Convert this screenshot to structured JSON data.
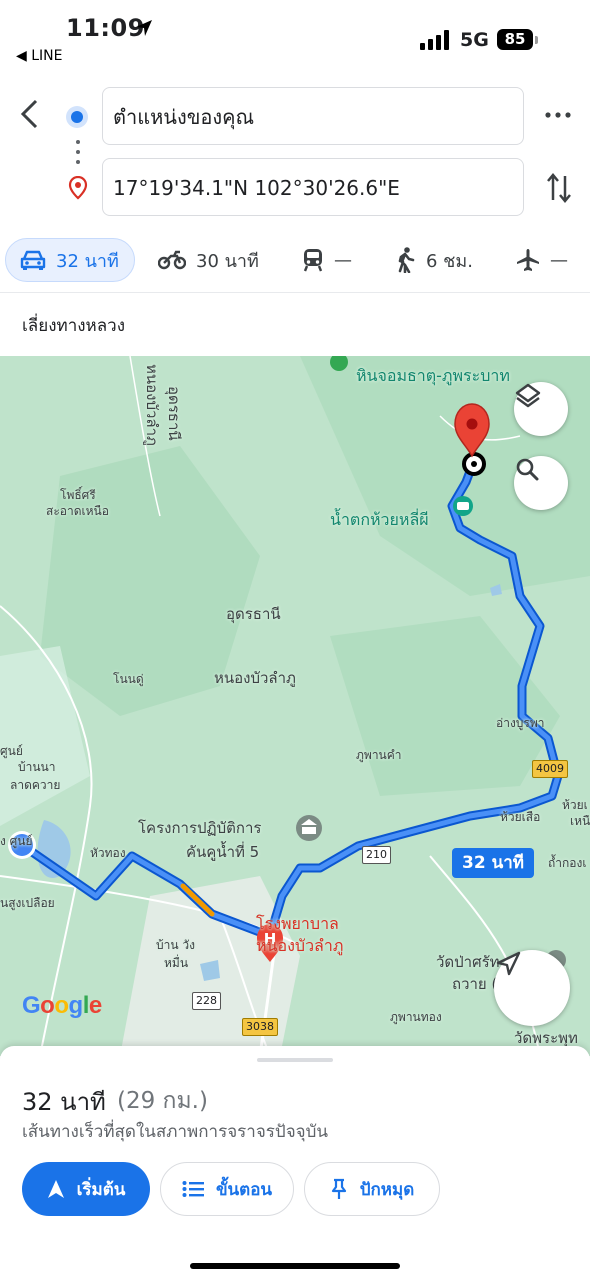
{
  "status_bar": {
    "time": "11:09",
    "back_app": "◀ LINE",
    "network": "5G",
    "battery": "85"
  },
  "directions": {
    "origin": "ตำแหน่งของคุณ",
    "destination": "17°19'34.1\"N 102°30'26.6\"E"
  },
  "modes": [
    {
      "id": "car",
      "label": "32 นาที",
      "icon": "car-icon",
      "selected": true
    },
    {
      "id": "motorbike",
      "label": "30 นาที",
      "icon": "motorbike-icon"
    },
    {
      "id": "transit",
      "label": "—",
      "icon": "train-icon"
    },
    {
      "id": "walk",
      "label": "6 ชม.",
      "icon": "walk-icon"
    },
    {
      "id": "flight",
      "label": "—",
      "icon": "flight-icon"
    }
  ],
  "avoid_label": "เลี่ยงทางหลวง",
  "map": {
    "labels": {
      "rock_pillar": "หินจอมธาตุ-ภูพระบาท",
      "udon_rotated": "อุดรธานี",
      "nongbua_rotated": "หนองบัวลำภู",
      "pho_si": "โพธิ์ศรี",
      "sa_at_nuea": "สะอาดเหนือ",
      "waterfall": "น้ำตกห้วยหลี่ผี",
      "udon": "อุดรธานี",
      "nongbua": "หนองบัวลำภู",
      "non_du": "โนนดู่",
      "ang_burapha": "อ่างบูรพา",
      "phu_phan_kham": "ภูพานคำ",
      "ban_na": "บ้านนา",
      "lat_khwai": "ลาดควาย",
      "sun": "ศูนย์",
      "project": "โครงการปฏิบัติการ",
      "project2": "คันคูน้ำที่ 5",
      "hua_thong": "หัวทอง",
      "huai_suea": "ห้วยเสือ",
      "huai_se": "ห้วยเ",
      "nuea": "เหนื",
      "tham_kong": "ถ้ำกองเ",
      "nong_sung": "นสูงเปลือย",
      "ban_wang": "บ้าน วัง",
      "muen": "หมื่น",
      "hospital1": "โรงพยาบาล",
      "hospital2": "หนองบัวลำภู",
      "wat_pa": "วัดป่าศรัท",
      "thawai": "ถวาย (ถ้ำ",
      "phu_phan_thong": "ภูพานทอง",
      "wat_phra": "วัดพระพุท",
      "google": "Google",
      "left_sun": "ง ศูนย์"
    },
    "shields": {
      "r4009": "4009",
      "r210": "210",
      "r228": "228",
      "r3038": "3038"
    },
    "route_badge": "32 นาที",
    "colors": {
      "route": "#1a73e8",
      "route_outline": "#0b57d0",
      "traffic": "#f29900",
      "destination_pin": "#ea4335",
      "map_bg": "#b8dfc6"
    }
  },
  "sheet": {
    "time": "32 นาที",
    "distance": "(29 กม.)",
    "note": "เส้นทางเร็วที่สุดในสภาพการจราจรปัจจุบัน",
    "start": "เริ่มต้น",
    "steps": "ขั้นตอน",
    "pin": "ปักหมุด"
  }
}
